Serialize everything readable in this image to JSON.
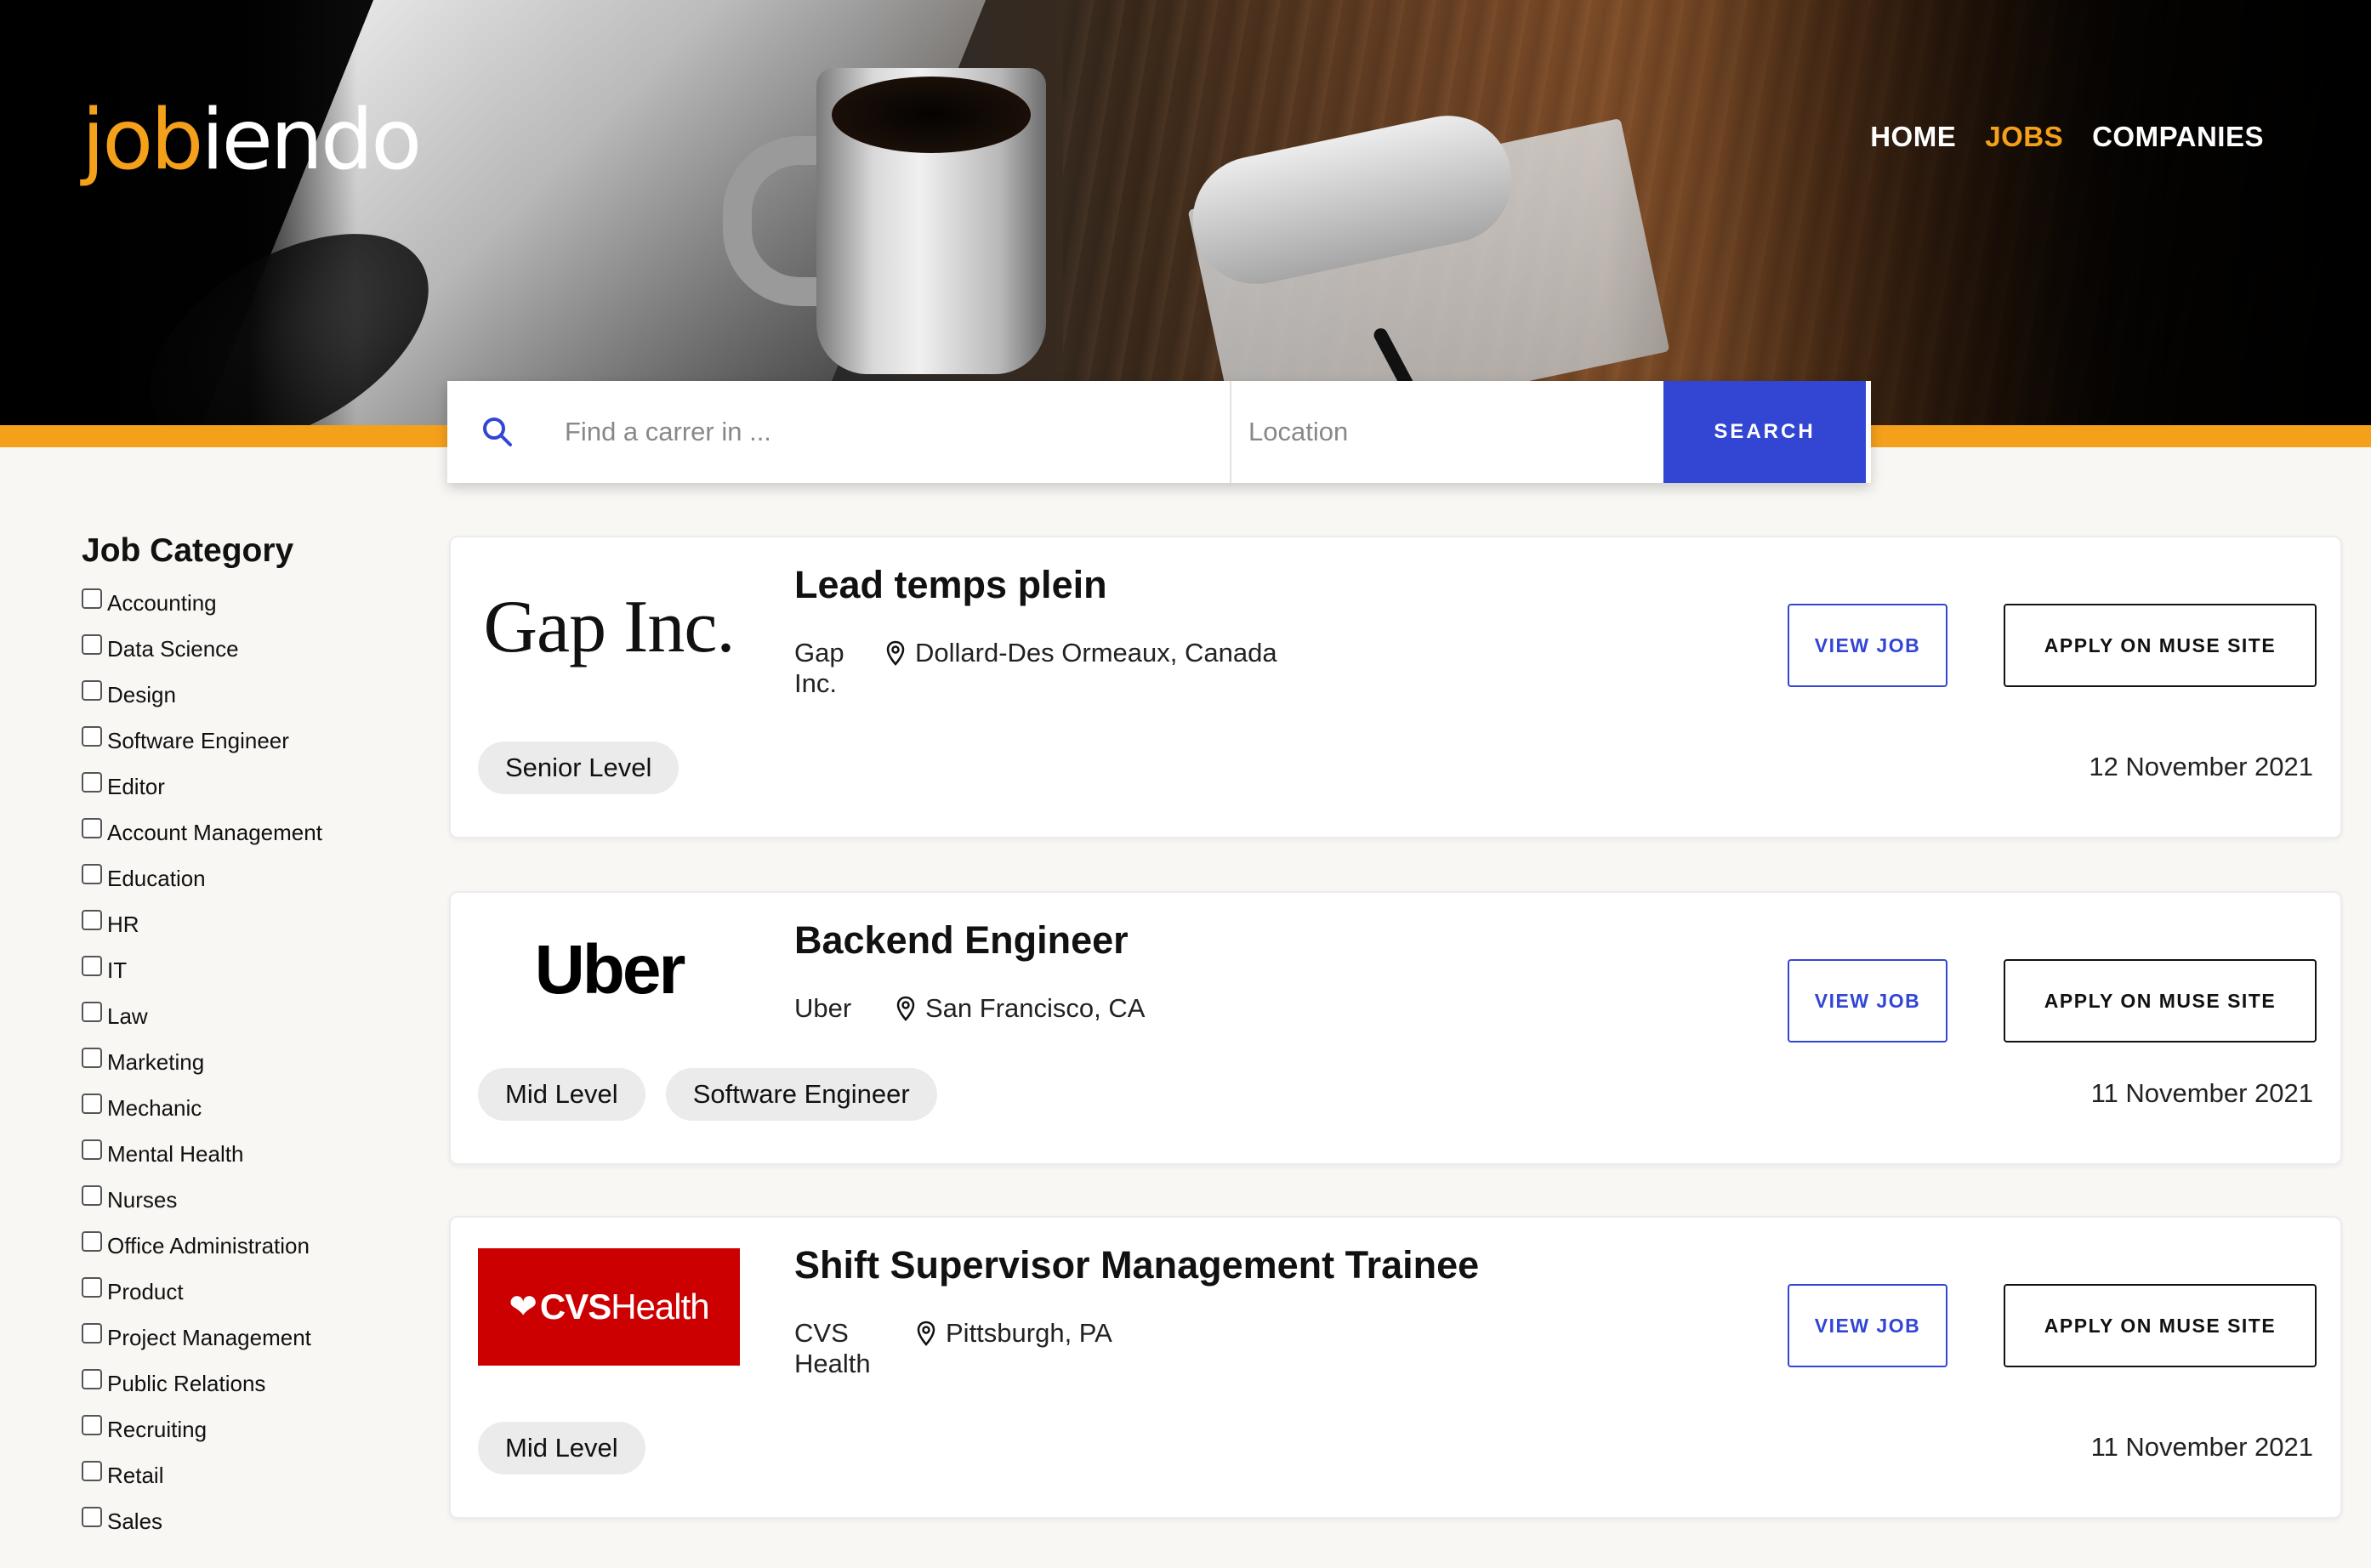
{
  "brand": {
    "logo_part1": "job",
    "logo_part2": "iendo",
    "accent": "#f5a01a",
    "primary": "#3346d3"
  },
  "nav": [
    {
      "label": "HOME",
      "active": false
    },
    {
      "label": "JOBS",
      "active": true
    },
    {
      "label": "COMPANIES",
      "active": false
    }
  ],
  "search": {
    "career_placeholder": "Find a carrer in ...",
    "location_placeholder": "Location",
    "button_label": "SEARCH",
    "icon": "search-icon"
  },
  "sidebar": {
    "title": "Job Category",
    "categories": [
      "Accounting",
      "Data Science",
      "Design",
      "Software Engineer",
      "Editor",
      "Account Management",
      "Education",
      "HR",
      "IT",
      "Law",
      "Marketing",
      "Mechanic",
      "Mental Health",
      "Nurses",
      "Office Administration",
      "Product",
      "Project Management",
      "Public Relations",
      "Recruiting",
      "Retail",
      "Sales"
    ]
  },
  "jobs": [
    {
      "logo_text": "Gap Inc.",
      "title": "Lead temps plein",
      "company": "Gap Inc.",
      "location": "Dollard-Des Ormeaux, Canada",
      "tags": [
        "Senior Level"
      ],
      "date": "12 November 2021",
      "view_label": "VIEW JOB",
      "apply_label": "APPLY ON MUSE SITE"
    },
    {
      "logo_text": "Uber",
      "title": "Backend Engineer",
      "company": "Uber",
      "location": "San Francisco, CA",
      "tags": [
        "Mid Level",
        "Software Engineer"
      ],
      "date": "11 November 2021",
      "view_label": "VIEW JOB",
      "apply_label": "APPLY ON MUSE SITE"
    },
    {
      "logo_text_bold": "CVS",
      "logo_text": "Health",
      "title": "Shift Supervisor Management Trainee",
      "company": "CVS Health",
      "location": "Pittsburgh, PA",
      "tags": [
        "Mid Level"
      ],
      "date": "11 November 2021",
      "view_label": "VIEW JOB",
      "apply_label": "APPLY ON MUSE SITE"
    }
  ]
}
